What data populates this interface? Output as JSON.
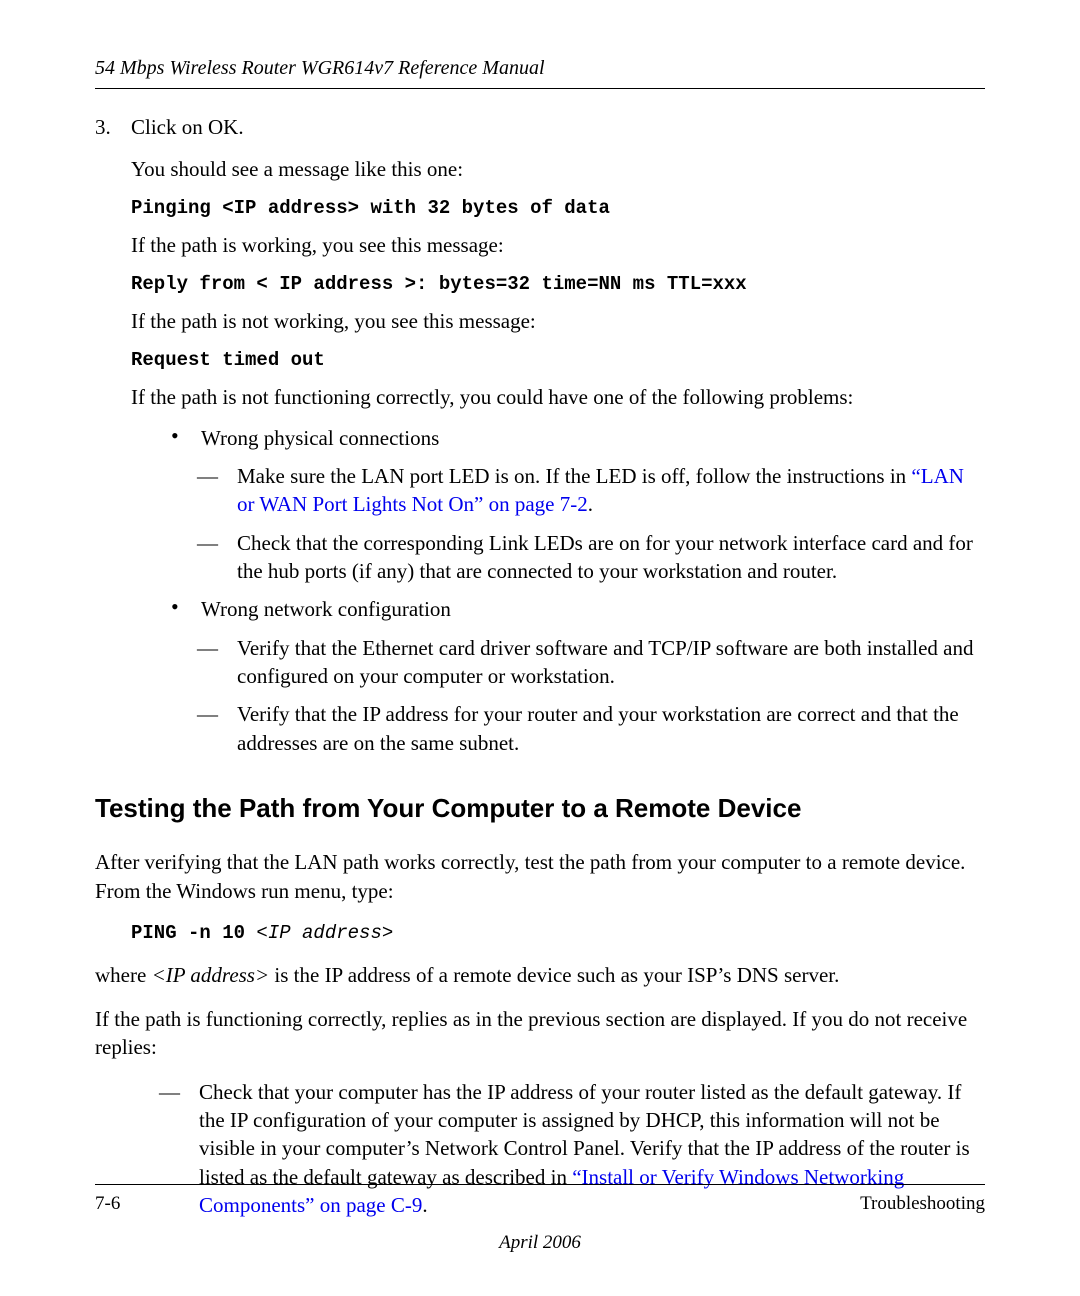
{
  "header": "54 Mbps Wireless Router WGR614v7 Reference Manual",
  "step3": {
    "num": "3.",
    "text": "Click on OK.",
    "msg_intro": "You should see a message like this one:",
    "code1": "Pinging <IP address> with 32 bytes of data",
    "path_working": "If the path is working, you see this message:",
    "code2": "Reply from < IP address >: bytes=32 time=NN ms TTL=xxx",
    "path_not_working": "If the path is not working, you see this message:",
    "code3": "Request timed out",
    "not_functioning": "If the path is not functioning correctly, you could have one of the following problems:"
  },
  "bullets": {
    "b1": "Wrong physical connections",
    "b1_d1_pre": "Make sure the LAN port LED is on. If the LED is off, follow the instructions in ",
    "b1_d1_link": "“LAN or WAN Port Lights Not On” on page 7-2",
    "b1_d1_post": ".",
    "b1_d2": "Check that the corresponding Link LEDs are on for your network interface card and for the hub ports (if any) that are connected to your workstation and router.",
    "b2": "Wrong network configuration",
    "b2_d1": "Verify that the Ethernet card driver software and TCP/IP software are both installed and configured on your computer or workstation.",
    "b2_d2": "Verify that the IP address for your router and your workstation are correct and that the addresses are on the same subnet."
  },
  "section_title": "Testing the Path from Your Computer to a Remote Device",
  "section": {
    "p1": "After verifying that the LAN path works correctly, test the path from your computer to a remote device. From the Windows run menu, type:",
    "ping_cmd": "PING -n 10 ",
    "ping_placeholder": "<IP address>",
    "p2_pre": "where ",
    "p2_ital": "<IP address>",
    "p2_post": " is the IP address of a remote device such as your ISP’s DNS server.",
    "p3": "If the path is functioning correctly, replies as in the previous section are displayed. If you do not receive replies:",
    "check1_pre": "Check that your computer has the IP address of your router listed as the default gateway. If the IP configuration of your computer is assigned by DHCP, this information will not be visible in your computer’s Network Control Panel. Verify that the IP address of the router is listed as the default gateway as described in ",
    "check1_link": "“Install or Verify Windows Networking Components” on page C-9",
    "check1_post": "."
  },
  "footer": {
    "page": "7-6",
    "section": "Troubleshooting",
    "date": "April 2006"
  }
}
